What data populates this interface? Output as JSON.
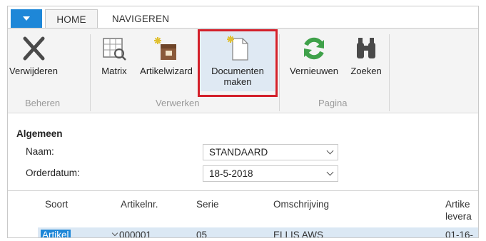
{
  "tabs": {
    "home": "HOME",
    "navigate": "NAVIGEREN"
  },
  "ribbon": {
    "buttons": [
      {
        "label": "Verwijderen"
      },
      {
        "label": "Matrix"
      },
      {
        "label": "Artikelwizard"
      },
      {
        "label": "Documenten maken"
      },
      {
        "label": "Vernieuwen"
      },
      {
        "label": "Zoeken"
      }
    ],
    "groups": {
      "beheren": "Beheren",
      "verwerken": "Verwerken",
      "pagina": "Pagina"
    }
  },
  "form": {
    "section_title": "Algemeen",
    "naam": {
      "label": "Naam:",
      "value": "STANDAARD"
    },
    "orderdatum": {
      "label": "Orderdatum:",
      "value": "18-5-2018"
    }
  },
  "grid": {
    "columns": [
      "Soort",
      "Artikelnr.",
      "Serie",
      "Omschrijving",
      "Artike levera"
    ],
    "row": {
      "soort": "Artikel",
      "artikelnr": "000001",
      "serie": "05",
      "omschrijving": "ELLIS AWS",
      "datum": "01-16-"
    }
  },
  "colors": {
    "accent": "#1e87d8",
    "highlight": "#d3202a",
    "ribbon_bg": "#f4f4f4"
  }
}
